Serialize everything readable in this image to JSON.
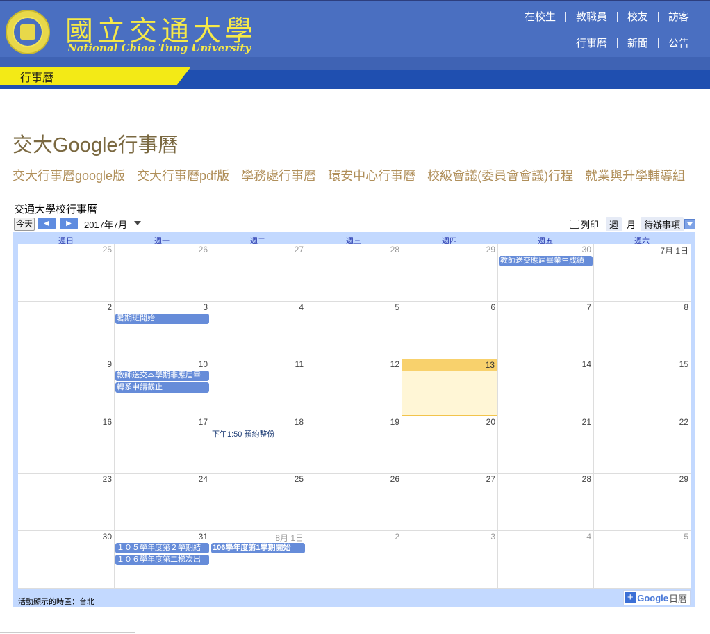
{
  "header": {
    "logo_zh": "國立交通大學",
    "logo_en": "National Chiao Tung University",
    "nav_row1": [
      "在校生",
      "教職員",
      "校友",
      "訪客"
    ],
    "nav_row2": [
      "行事曆",
      "新聞",
      "公告"
    ],
    "section_tab": "行事曆",
    "colors": {
      "header_bg": "#4a6fc1",
      "band": "#1f4fb0",
      "tab": "#f3ea16",
      "logo": "#f6e948"
    }
  },
  "main": {
    "title": "交大Google行事曆",
    "links": [
      "交大行事曆google版",
      "交大行事曆pdf版",
      "學務處行事曆",
      "環安中心行事曆",
      "校級會議(委員會會議)行程",
      "就業與升學輔導組"
    ]
  },
  "calendar": {
    "name": "交通大學校行事曆",
    "today_button": "今天",
    "month_label": "2017年7月",
    "print_label": "列印",
    "view_tabs": [
      "週",
      "月",
      "待辦事項"
    ],
    "active_view": "月",
    "day_headers": [
      "週日",
      "週一",
      "週二",
      "週三",
      "週四",
      "週五",
      "週六"
    ],
    "weeks": [
      [
        {
          "label": "25",
          "other": true,
          "events": []
        },
        {
          "label": "26",
          "other": true,
          "events": []
        },
        {
          "label": "27",
          "other": true,
          "events": []
        },
        {
          "label": "28",
          "other": true,
          "events": []
        },
        {
          "label": "29",
          "other": true,
          "events": []
        },
        {
          "label": "30",
          "other": true,
          "events": [
            {
              "title": "教師送交應屆畢業生成績",
              "style": "bar"
            }
          ]
        },
        {
          "label": "7月 1日",
          "other": false,
          "events": []
        }
      ],
      [
        {
          "label": "2",
          "other": false,
          "events": []
        },
        {
          "label": "3",
          "other": false,
          "events": [
            {
              "title": "暑期班開始",
              "style": "bar"
            }
          ]
        },
        {
          "label": "4",
          "other": false,
          "events": []
        },
        {
          "label": "5",
          "other": false,
          "events": []
        },
        {
          "label": "6",
          "other": false,
          "events": []
        },
        {
          "label": "7",
          "other": false,
          "events": []
        },
        {
          "label": "8",
          "other": false,
          "events": []
        }
      ],
      [
        {
          "label": "9",
          "other": false,
          "events": []
        },
        {
          "label": "10",
          "other": false,
          "events": [
            {
              "title": "教師送交本學期非應屆畢",
              "style": "bar"
            },
            {
              "title": "轉系申請截止",
              "style": "bar"
            }
          ]
        },
        {
          "label": "11",
          "other": false,
          "events": []
        },
        {
          "label": "12",
          "other": false,
          "events": []
        },
        {
          "label": "13",
          "other": false,
          "today": true,
          "events": []
        },
        {
          "label": "14",
          "other": false,
          "events": []
        },
        {
          "label": "15",
          "other": false,
          "events": []
        }
      ],
      [
        {
          "label": "16",
          "other": false,
          "events": []
        },
        {
          "label": "17",
          "other": false,
          "events": []
        },
        {
          "label": "18",
          "other": false,
          "events": [
            {
              "title": "下午1:50 預約整份",
              "style": "text"
            }
          ]
        },
        {
          "label": "19",
          "other": false,
          "events": []
        },
        {
          "label": "20",
          "other": false,
          "events": []
        },
        {
          "label": "21",
          "other": false,
          "events": []
        },
        {
          "label": "22",
          "other": false,
          "events": []
        }
      ],
      [
        {
          "label": "23",
          "other": false,
          "events": []
        },
        {
          "label": "24",
          "other": false,
          "events": []
        },
        {
          "label": "25",
          "other": false,
          "events": []
        },
        {
          "label": "26",
          "other": false,
          "events": []
        },
        {
          "label": "27",
          "other": false,
          "events": []
        },
        {
          "label": "28",
          "other": false,
          "events": []
        },
        {
          "label": "29",
          "other": false,
          "events": []
        }
      ],
      [
        {
          "label": "30",
          "other": false,
          "events": []
        },
        {
          "label": "31",
          "other": false,
          "events": [
            {
              "title": "１０５學年度第２學期結",
              "style": "bar"
            },
            {
              "title": "１０６學年度第二梯次出",
              "style": "bar"
            }
          ]
        },
        {
          "label": "8月 1日",
          "other": true,
          "events": [
            {
              "title": "106學年度第1學期開始",
              "style": "bar-bold"
            }
          ]
        },
        {
          "label": "2",
          "other": true,
          "events": []
        },
        {
          "label": "3",
          "other": true,
          "events": []
        },
        {
          "label": "4",
          "other": true,
          "events": []
        },
        {
          "label": "5",
          "other": true,
          "events": []
        }
      ]
    ],
    "timezone_note": "活動顯示的時區：台北",
    "google_badge": {
      "brand": "Google",
      "suffix": "日曆"
    },
    "colors": {
      "frame": "#c3d9ff",
      "event": "#668cd9",
      "today": "#fff6d6",
      "today_header": "#f8d16c"
    }
  }
}
